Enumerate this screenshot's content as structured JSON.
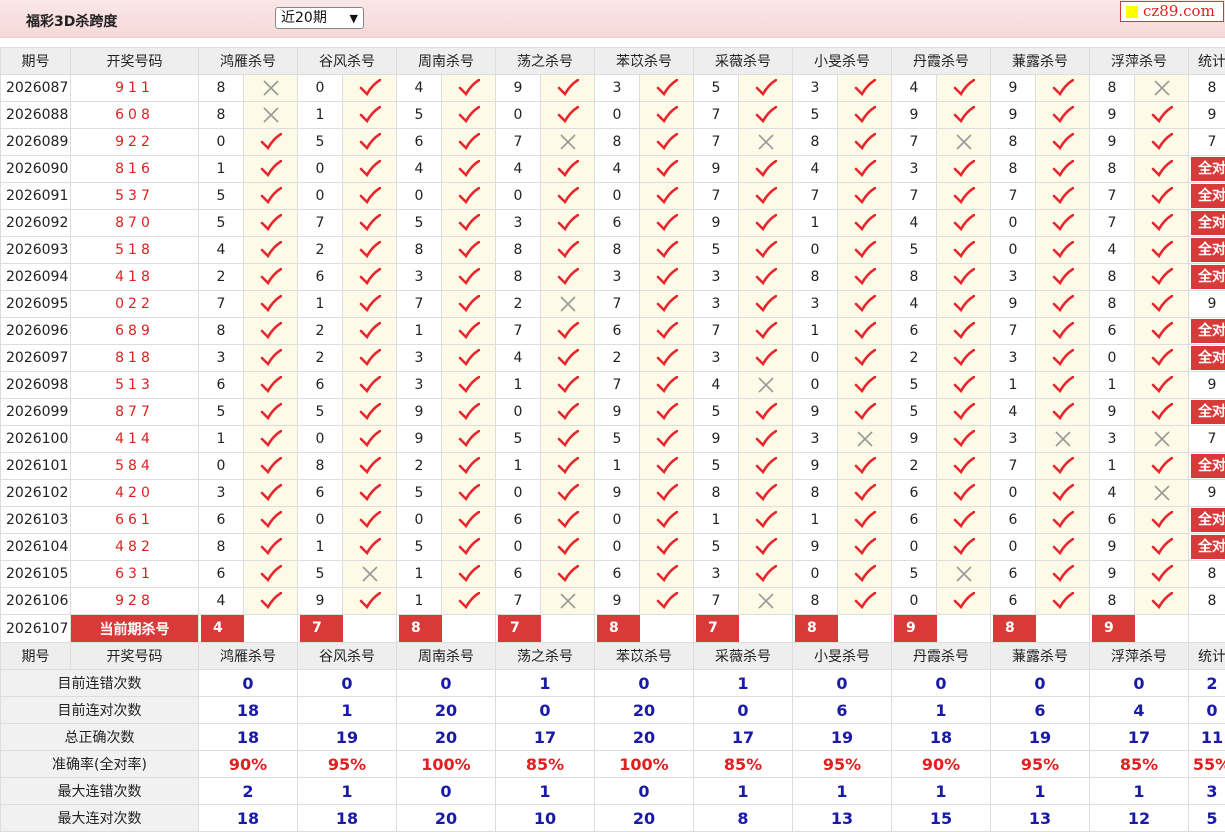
{
  "header": {
    "title": "福彩3D杀跨度",
    "period_select": "近20期",
    "logo_text": "cz89.com"
  },
  "table": {
    "headers": [
      "期号",
      "开奖号码",
      "鸿雁杀号",
      "谷风杀号",
      "周南杀号",
      "荡之杀号",
      "苯苡杀号",
      "采薇杀号",
      "小旻杀号",
      "丹霞杀号",
      "蒹露杀号",
      "浮萍杀号",
      "统计"
    ],
    "rows": [
      {
        "p": "2026087",
        "d": "911",
        "k": [
          [
            8,
            0
          ],
          [
            0,
            1
          ],
          [
            4,
            1
          ],
          [
            9,
            1
          ],
          [
            3,
            1
          ],
          [
            5,
            1
          ],
          [
            3,
            1
          ],
          [
            4,
            1
          ],
          [
            9,
            1
          ],
          [
            8,
            0
          ]
        ],
        "s": "8"
      },
      {
        "p": "2026088",
        "d": "608",
        "k": [
          [
            8,
            0
          ],
          [
            1,
            1
          ],
          [
            5,
            1
          ],
          [
            0,
            1
          ],
          [
            0,
            1
          ],
          [
            7,
            1
          ],
          [
            5,
            1
          ],
          [
            9,
            1
          ],
          [
            9,
            1
          ],
          [
            9,
            1
          ]
        ],
        "s": "9"
      },
      {
        "p": "2026089",
        "d": "922",
        "k": [
          [
            0,
            1
          ],
          [
            5,
            1
          ],
          [
            6,
            1
          ],
          [
            7,
            0
          ],
          [
            8,
            1
          ],
          [
            7,
            0
          ],
          [
            8,
            1
          ],
          [
            7,
            0
          ],
          [
            8,
            1
          ],
          [
            9,
            1
          ]
        ],
        "s": "7"
      },
      {
        "p": "2026090",
        "d": "816",
        "k": [
          [
            1,
            1
          ],
          [
            0,
            1
          ],
          [
            4,
            1
          ],
          [
            4,
            1
          ],
          [
            4,
            1
          ],
          [
            9,
            1
          ],
          [
            4,
            1
          ],
          [
            3,
            1
          ],
          [
            8,
            1
          ],
          [
            8,
            1
          ]
        ],
        "s": "全对"
      },
      {
        "p": "2026091",
        "d": "537",
        "k": [
          [
            5,
            1
          ],
          [
            0,
            1
          ],
          [
            0,
            1
          ],
          [
            0,
            1
          ],
          [
            0,
            1
          ],
          [
            7,
            1
          ],
          [
            7,
            1
          ],
          [
            7,
            1
          ],
          [
            7,
            1
          ],
          [
            7,
            1
          ]
        ],
        "s": "全对"
      },
      {
        "p": "2026092",
        "d": "870",
        "k": [
          [
            5,
            1
          ],
          [
            7,
            1
          ],
          [
            5,
            1
          ],
          [
            3,
            1
          ],
          [
            6,
            1
          ],
          [
            9,
            1
          ],
          [
            1,
            1
          ],
          [
            4,
            1
          ],
          [
            0,
            1
          ],
          [
            7,
            1
          ]
        ],
        "s": "全对"
      },
      {
        "p": "2026093",
        "d": "518",
        "k": [
          [
            4,
            1
          ],
          [
            2,
            1
          ],
          [
            8,
            1
          ],
          [
            8,
            1
          ],
          [
            8,
            1
          ],
          [
            5,
            1
          ],
          [
            0,
            1
          ],
          [
            5,
            1
          ],
          [
            0,
            1
          ],
          [
            4,
            1
          ]
        ],
        "s": "全对"
      },
      {
        "p": "2026094",
        "d": "418",
        "k": [
          [
            2,
            1
          ],
          [
            6,
            1
          ],
          [
            3,
            1
          ],
          [
            8,
            1
          ],
          [
            3,
            1
          ],
          [
            3,
            1
          ],
          [
            8,
            1
          ],
          [
            8,
            1
          ],
          [
            3,
            1
          ],
          [
            8,
            1
          ]
        ],
        "s": "全对"
      },
      {
        "p": "2026095",
        "d": "022",
        "k": [
          [
            7,
            1
          ],
          [
            1,
            1
          ],
          [
            7,
            1
          ],
          [
            2,
            0
          ],
          [
            7,
            1
          ],
          [
            3,
            1
          ],
          [
            3,
            1
          ],
          [
            4,
            1
          ],
          [
            9,
            1
          ],
          [
            8,
            1
          ]
        ],
        "s": "9"
      },
      {
        "p": "2026096",
        "d": "689",
        "k": [
          [
            8,
            1
          ],
          [
            2,
            1
          ],
          [
            1,
            1
          ],
          [
            7,
            1
          ],
          [
            6,
            1
          ],
          [
            7,
            1
          ],
          [
            1,
            1
          ],
          [
            6,
            1
          ],
          [
            7,
            1
          ],
          [
            6,
            1
          ]
        ],
        "s": "全对"
      },
      {
        "p": "2026097",
        "d": "818",
        "k": [
          [
            3,
            1
          ],
          [
            2,
            1
          ],
          [
            3,
            1
          ],
          [
            4,
            1
          ],
          [
            2,
            1
          ],
          [
            3,
            1
          ],
          [
            0,
            1
          ],
          [
            2,
            1
          ],
          [
            3,
            1
          ],
          [
            0,
            1
          ]
        ],
        "s": "全对"
      },
      {
        "p": "2026098",
        "d": "513",
        "k": [
          [
            6,
            1
          ],
          [
            6,
            1
          ],
          [
            3,
            1
          ],
          [
            1,
            1
          ],
          [
            7,
            1
          ],
          [
            4,
            0
          ],
          [
            0,
            1
          ],
          [
            5,
            1
          ],
          [
            1,
            1
          ],
          [
            1,
            1
          ]
        ],
        "s": "9"
      },
      {
        "p": "2026099",
        "d": "877",
        "k": [
          [
            5,
            1
          ],
          [
            5,
            1
          ],
          [
            9,
            1
          ],
          [
            0,
            1
          ],
          [
            9,
            1
          ],
          [
            5,
            1
          ],
          [
            9,
            1
          ],
          [
            5,
            1
          ],
          [
            4,
            1
          ],
          [
            9,
            1
          ]
        ],
        "s": "全对"
      },
      {
        "p": "2026100",
        "d": "414",
        "k": [
          [
            1,
            1
          ],
          [
            0,
            1
          ],
          [
            9,
            1
          ],
          [
            5,
            1
          ],
          [
            5,
            1
          ],
          [
            9,
            1
          ],
          [
            3,
            0
          ],
          [
            9,
            1
          ],
          [
            3,
            0
          ],
          [
            3,
            0
          ]
        ],
        "s": "7"
      },
      {
        "p": "2026101",
        "d": "584",
        "k": [
          [
            0,
            1
          ],
          [
            8,
            1
          ],
          [
            2,
            1
          ],
          [
            1,
            1
          ],
          [
            1,
            1
          ],
          [
            5,
            1
          ],
          [
            9,
            1
          ],
          [
            2,
            1
          ],
          [
            7,
            1
          ],
          [
            1,
            1
          ]
        ],
        "s": "全对"
      },
      {
        "p": "2026102",
        "d": "420",
        "k": [
          [
            3,
            1
          ],
          [
            6,
            1
          ],
          [
            5,
            1
          ],
          [
            0,
            1
          ],
          [
            9,
            1
          ],
          [
            8,
            1
          ],
          [
            8,
            1
          ],
          [
            6,
            1
          ],
          [
            0,
            1
          ],
          [
            4,
            0
          ]
        ],
        "s": "9"
      },
      {
        "p": "2026103",
        "d": "661",
        "k": [
          [
            6,
            1
          ],
          [
            0,
            1
          ],
          [
            0,
            1
          ],
          [
            6,
            1
          ],
          [
            0,
            1
          ],
          [
            1,
            1
          ],
          [
            1,
            1
          ],
          [
            6,
            1
          ],
          [
            6,
            1
          ],
          [
            6,
            1
          ]
        ],
        "s": "全对"
      },
      {
        "p": "2026104",
        "d": "482",
        "k": [
          [
            8,
            1
          ],
          [
            1,
            1
          ],
          [
            5,
            1
          ],
          [
            0,
            1
          ],
          [
            0,
            1
          ],
          [
            5,
            1
          ],
          [
            9,
            1
          ],
          [
            0,
            1
          ],
          [
            0,
            1
          ],
          [
            9,
            1
          ]
        ],
        "s": "全对"
      },
      {
        "p": "2026105",
        "d": "631",
        "k": [
          [
            6,
            1
          ],
          [
            5,
            0
          ],
          [
            1,
            1
          ],
          [
            6,
            1
          ],
          [
            6,
            1
          ],
          [
            3,
            1
          ],
          [
            0,
            1
          ],
          [
            5,
            0
          ],
          [
            6,
            1
          ],
          [
            9,
            1
          ]
        ],
        "s": "8"
      },
      {
        "p": "2026106",
        "d": "928",
        "k": [
          [
            4,
            1
          ],
          [
            9,
            1
          ],
          [
            1,
            1
          ],
          [
            7,
            0
          ],
          [
            9,
            1
          ],
          [
            7,
            0
          ],
          [
            8,
            1
          ],
          [
            0,
            1
          ],
          [
            6,
            1
          ],
          [
            8,
            1
          ]
        ],
        "s": "8"
      }
    ],
    "current": {
      "p": "2026107",
      "label": "当前期杀号",
      "kills": [
        "4",
        "7",
        "8",
        "7",
        "8",
        "7",
        "8",
        "9",
        "8",
        "9"
      ]
    },
    "stats": [
      {
        "label": "目前连错次数",
        "vals": [
          "0",
          "0",
          "0",
          "1",
          "0",
          "1",
          "0",
          "0",
          "0",
          "0",
          "2"
        ],
        "rate": false
      },
      {
        "label": "目前连对次数",
        "vals": [
          "18",
          "1",
          "20",
          "0",
          "20",
          "0",
          "6",
          "1",
          "6",
          "4",
          "0"
        ],
        "rate": false
      },
      {
        "label": "总正确次数",
        "vals": [
          "18",
          "19",
          "20",
          "17",
          "20",
          "17",
          "19",
          "18",
          "19",
          "17",
          "11"
        ],
        "rate": false
      },
      {
        "label": "准确率(全对率)",
        "vals": [
          "90%",
          "95%",
          "100%",
          "85%",
          "100%",
          "85%",
          "95%",
          "90%",
          "95%",
          "85%",
          "55%"
        ],
        "rate": true
      },
      {
        "label": "最大连错次数",
        "vals": [
          "2",
          "1",
          "0",
          "1",
          "0",
          "1",
          "1",
          "1",
          "1",
          "1",
          "3"
        ],
        "rate": false
      },
      {
        "label": "最大连对次数",
        "vals": [
          "18",
          "18",
          "20",
          "10",
          "20",
          "8",
          "13",
          "15",
          "13",
          "12",
          "5"
        ],
        "rate": false
      }
    ]
  },
  "colors": {
    "check": "#e8262e",
    "cross": "#999999",
    "accent": "#d83a3a",
    "stat_blue": "#1a1aa8"
  }
}
